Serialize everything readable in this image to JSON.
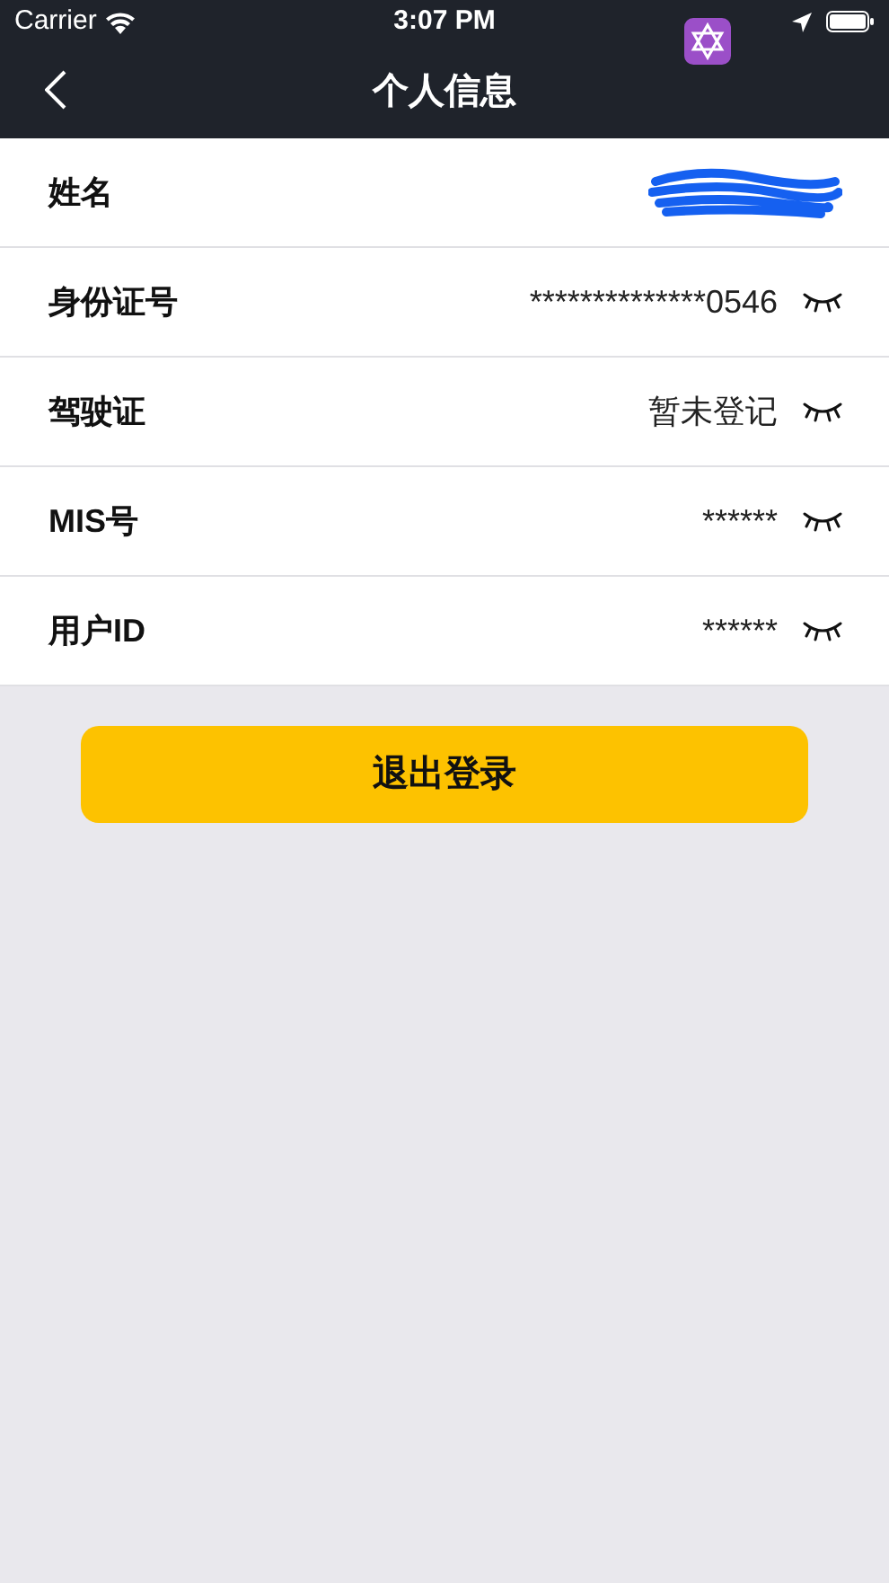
{
  "status_bar": {
    "carrier": "Carrier",
    "time": "3:07 PM"
  },
  "nav": {
    "title": "个人信息"
  },
  "rows": [
    {
      "label": "姓名",
      "kind": "redacted"
    },
    {
      "label": "身份证号",
      "value": "**************0546",
      "kind": "hidden"
    },
    {
      "label": "驾驶证",
      "value": "暂未登记",
      "kind": "hidden"
    },
    {
      "label": "MIS号",
      "value": "******",
      "kind": "hidden"
    },
    {
      "label": "用户ID",
      "value": "******",
      "kind": "hidden"
    }
  ],
  "logout_button": "退出登录"
}
